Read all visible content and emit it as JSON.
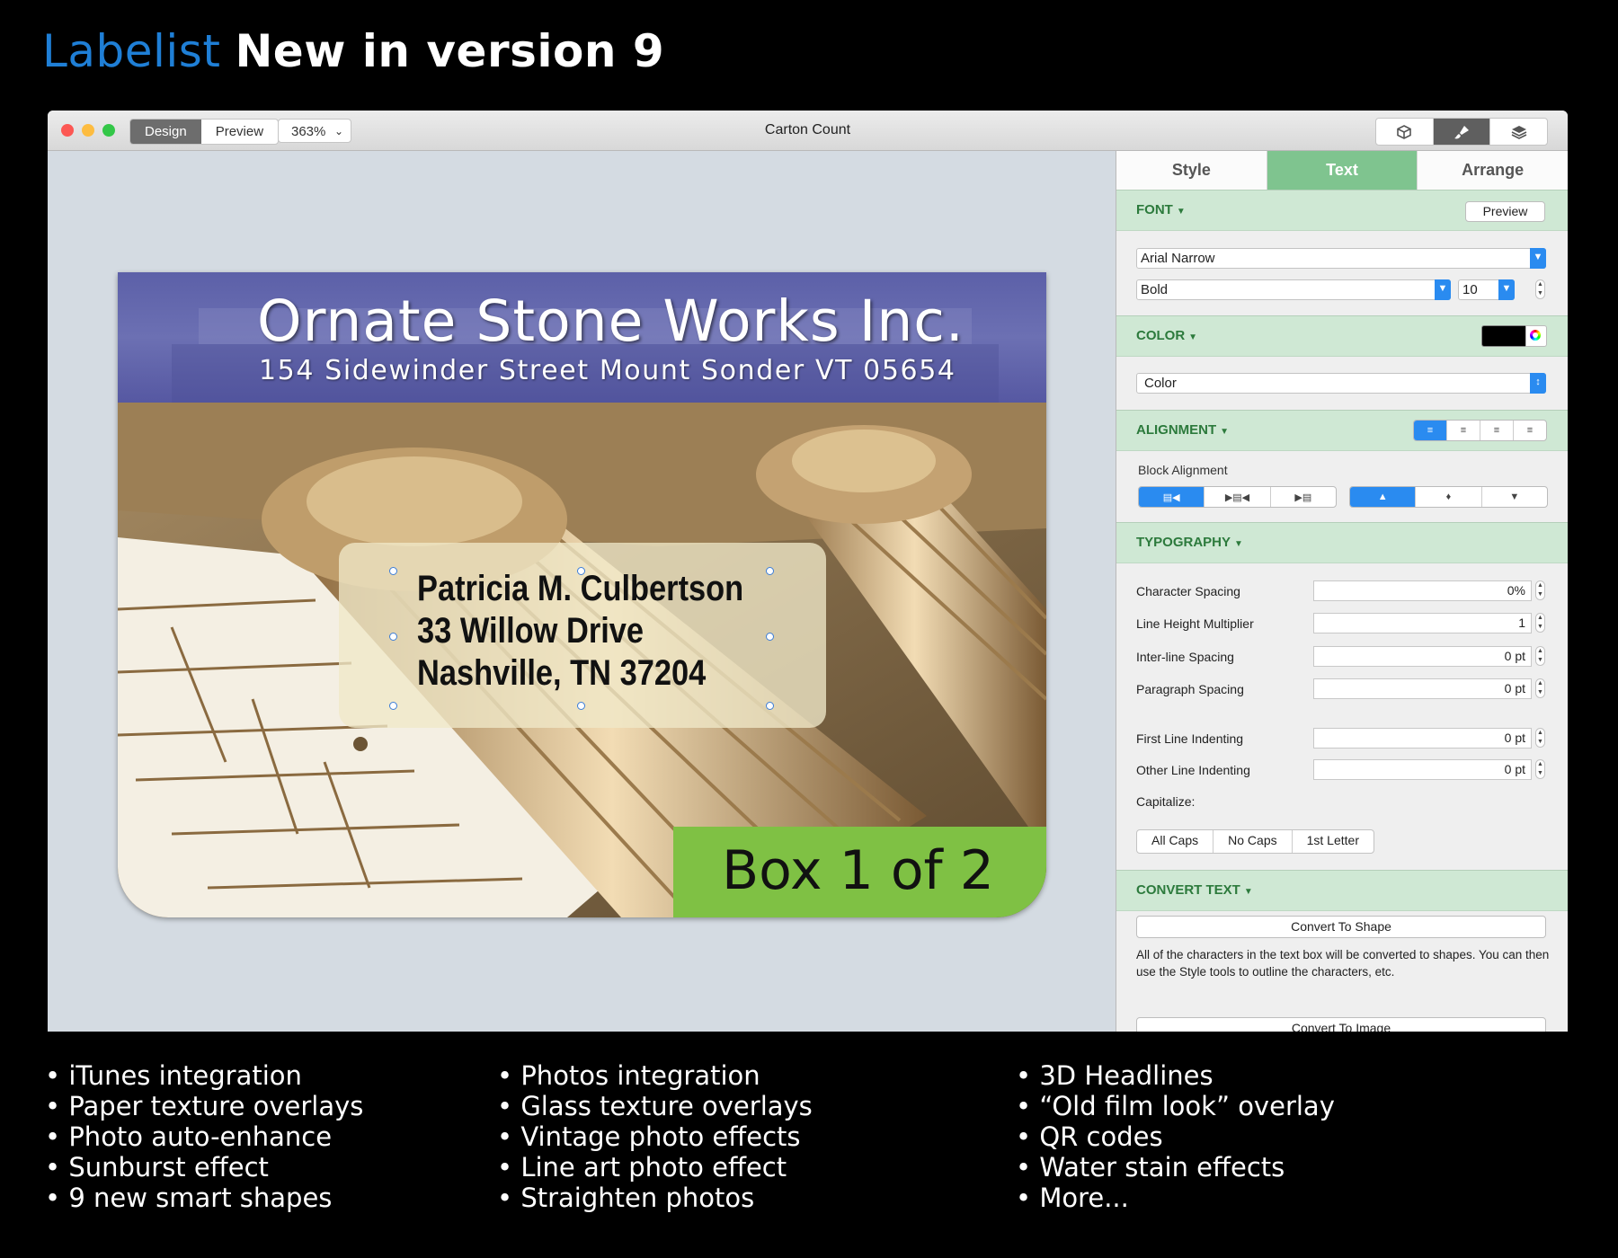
{
  "headline": {
    "brand": "Labelist",
    "rest": "New in version 9"
  },
  "window": {
    "title": "Carton Count",
    "mode_tabs": [
      "Design",
      "Preview"
    ],
    "zoom": "363%",
    "toolbar_icons": [
      "box-icon",
      "brush-icon",
      "layers-icon"
    ]
  },
  "label": {
    "company": "Ornate Stone Works Inc.",
    "address": "154 Sidewinder Street Mount Sonder VT 05654",
    "recipient": [
      "Patricia M. Culbertson",
      "33 Willow Drive",
      "Nashville, TN 37204"
    ],
    "box": "Box 1 of 2"
  },
  "panel": {
    "tabs": [
      "Style",
      "Text",
      "Arrange"
    ],
    "font": {
      "heading": "FONT",
      "preview": "Preview",
      "family": "Arial Narrow",
      "weight": "Bold",
      "size": "10"
    },
    "color": {
      "heading": "COLOR",
      "swatch": "#000000",
      "mode": "Color"
    },
    "alignment": {
      "heading": "ALIGNMENT",
      "block_label": "Block Alignment"
    },
    "typography": {
      "heading": "TYPOGRAPHY",
      "rows": [
        {
          "label": "Character Spacing",
          "value": "0%"
        },
        {
          "label": "Line Height Multiplier",
          "value": "1"
        },
        {
          "label": "Inter-line Spacing",
          "value": "0 pt"
        },
        {
          "label": "Paragraph Spacing",
          "value": "0 pt"
        },
        {
          "label": "First Line Indenting",
          "value": "0 pt"
        },
        {
          "label": "Other Line Indenting",
          "value": "0 pt"
        }
      ],
      "capitalize_label": "Capitalize:",
      "capitalize_options": [
        "All Caps",
        "No Caps",
        "1st Letter"
      ]
    },
    "convert": {
      "heading": "CONVERT TEXT",
      "to_shape": "Convert To Shape",
      "description": "All of the characters in the text box will be converted to shapes. You can then use the Style tools to outline the characters, etc.",
      "to_image": "Convert To Image"
    }
  },
  "features": {
    "col1": [
      "• iTunes integration",
      "• Paper texture overlays",
      "• Photo auto-enhance",
      "• Sunburst effect",
      "• 9 new smart shapes"
    ],
    "col2": [
      "• Photos integration",
      "• Glass texture overlays",
      "• Vintage photo effects",
      "• Line art photo effect",
      "• Straighten photos"
    ],
    "col3": [
      "• 3D Headlines",
      "• “Old film look” overlay",
      "• QR codes",
      "• Water stain effects",
      "• More..."
    ]
  },
  "colors": {
    "brand": "#1f7fd6",
    "accent_green": "#7fc48f",
    "badge_green": "#7fc144",
    "select_blue": "#2a8bf0"
  }
}
